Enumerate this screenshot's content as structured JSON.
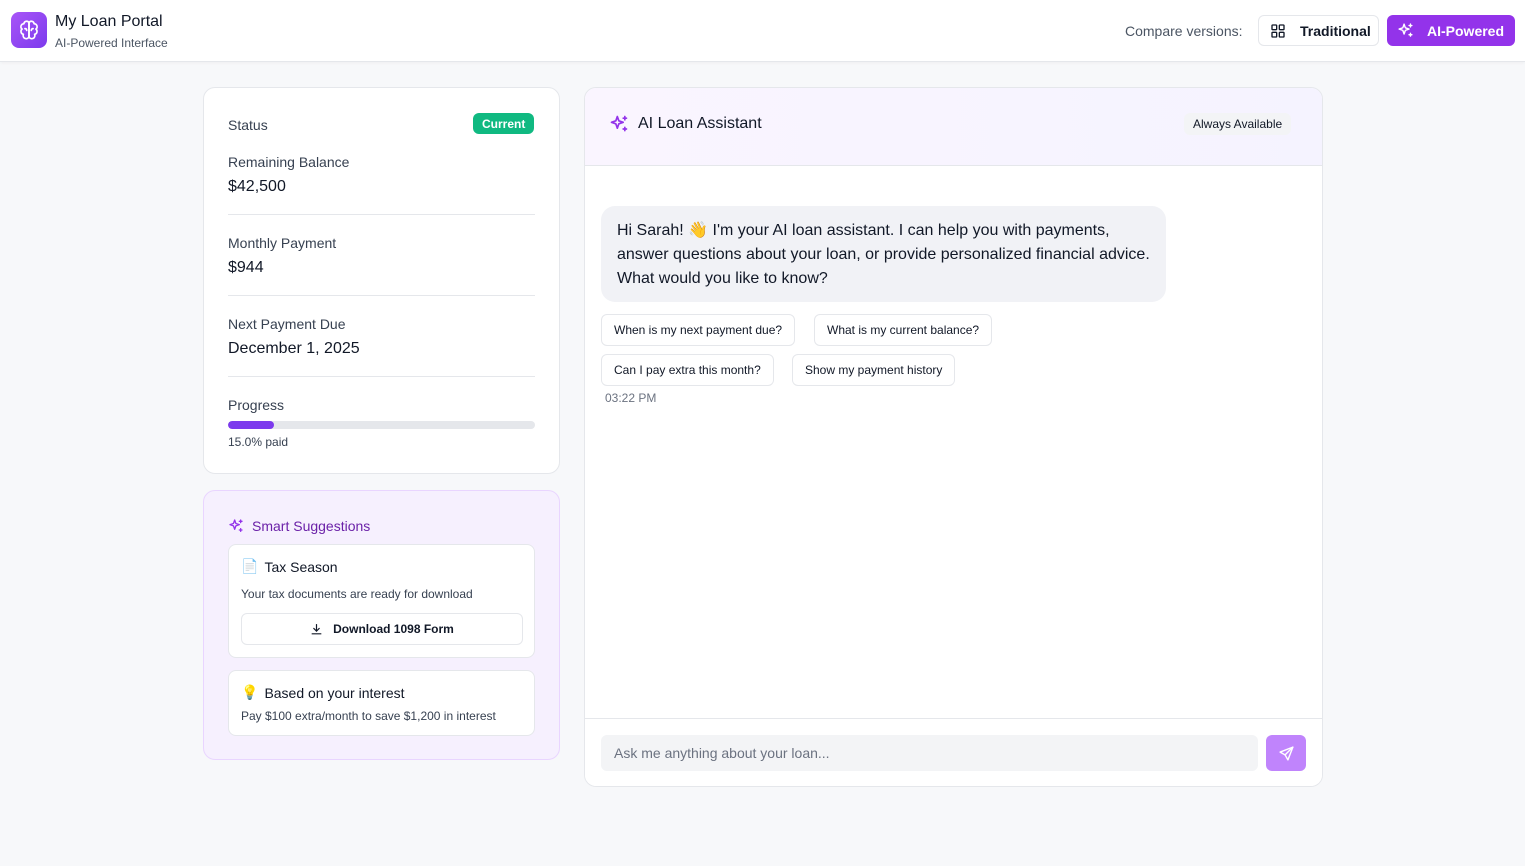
{
  "header": {
    "app_title": "My Loan Portal",
    "app_subtitle": "AI-Powered Interface",
    "compare_label": "Compare versions:",
    "traditional_label": "Traditional",
    "ai_label": "AI-Powered",
    "accent_color": "#9333ea"
  },
  "loan": {
    "status_label": "Status",
    "status_value": "Current",
    "balance_label": "Remaining Balance",
    "balance_value": "$42,500",
    "monthly_label": "Monthly Payment",
    "monthly_value": "$944",
    "due_label": "Next Payment Due",
    "due_value": "December 1, 2025",
    "progress_label": "Progress",
    "progress_percent": 15.0,
    "progress_text": "15.0% paid"
  },
  "suggestions": {
    "title": "Smart Suggestions",
    "items": [
      {
        "icon": "document-icon",
        "emoji": "📄",
        "title": "Tax Season",
        "desc": "Your tax documents are ready for download",
        "action_label": "Download 1098 Form"
      },
      {
        "icon": "lightbulb-icon",
        "emoji": "💡",
        "title": "Based on your interest",
        "desc": "Pay $100 extra/month to save $1,200 in interest"
      }
    ]
  },
  "chat": {
    "title": "AI Loan Assistant",
    "availability": "Always Available",
    "messages": [
      {
        "sender": "assistant",
        "text": "Hi Sarah! 👋 I'm your AI loan assistant. I can help you with payments, answer questions about your loan, or provide personalized financial advice. What would you like to know?",
        "time": "03:22 PM"
      }
    ],
    "quick_replies": [
      "When is my next payment due?",
      "What is my current balance?",
      "Can I pay extra this month?",
      "Show my payment history"
    ],
    "input_placeholder": "Ask me anything about your loan..."
  }
}
